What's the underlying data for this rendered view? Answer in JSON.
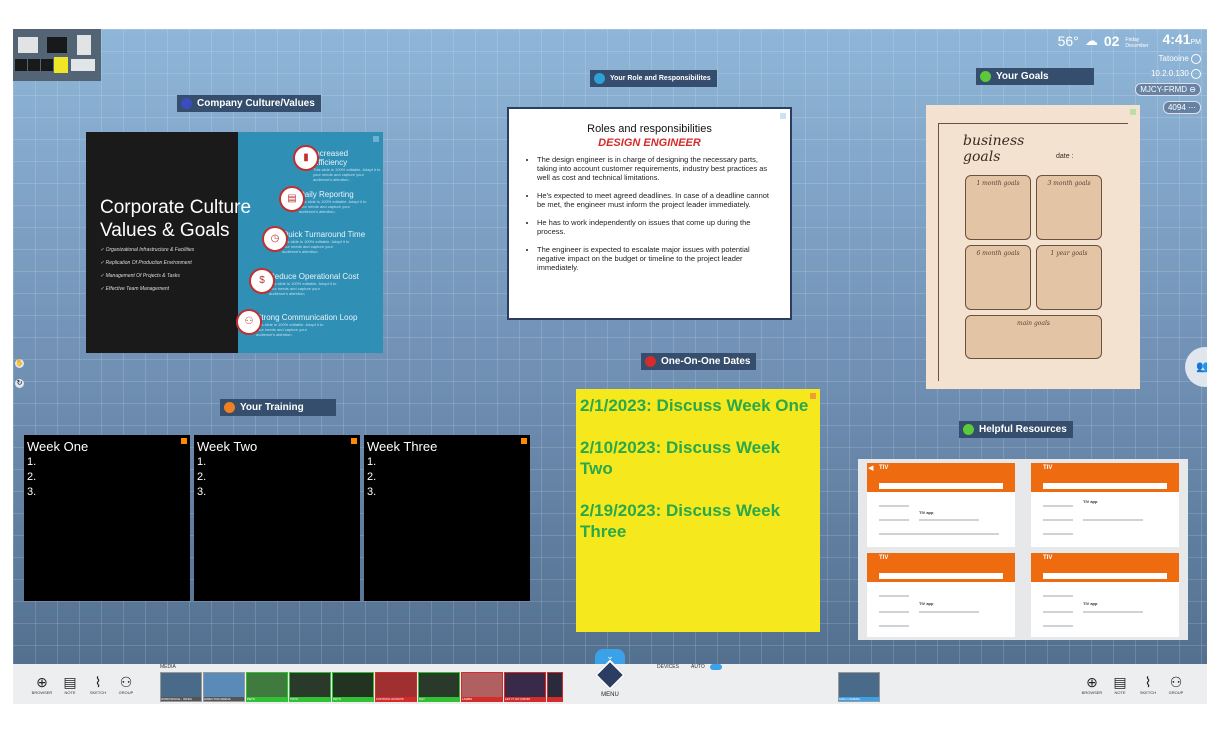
{
  "status": {
    "temperature": "56°",
    "day": "02",
    "day_label_top": "Friday",
    "day_label_bottom": "December",
    "time": "4:41",
    "ampm": "PM",
    "location": "Tatooine",
    "ip": "10.2.0.130",
    "device_code": "MJCY-FRMD",
    "users": "4094"
  },
  "labels": {
    "culture": "Company Culture/Values",
    "role": "Your Role and Responsibilites",
    "goals": "Your Goals",
    "one_on_one": "One-On-One Dates",
    "training": "Your Training",
    "resources": "Helpful Resources"
  },
  "colors": {
    "culture_dot": "#3b4cc0",
    "role_dot": "#2ea0d8",
    "goals_dot": "#5cc93a",
    "one_on_one_dot": "#d42b2b",
    "training_dot": "#f08020",
    "resources_dot": "#5cc93a"
  },
  "culture_slide": {
    "title_line1": "Corporate Culture",
    "title_line2": "Values & Goals",
    "bullets": [
      "Organizational Infrastructure & Facilities",
      "Replication Of Production Environment",
      "Management Of Projects & Tasks",
      "Effective Team Management"
    ],
    "items": [
      {
        "title": "Increased Efficiency",
        "text": "This slide is 100% editable. Adapt it to your needs and capture your audience's attention."
      },
      {
        "title": "Daily Reporting",
        "text": "This slide is 100% editable. Adapt it to your needs and capture your audience's attention."
      },
      {
        "title": "Quick Turnaround Time",
        "text": "This slide is 100% editable. Adapt it to your needs and capture your audience's attention."
      },
      {
        "title": "Reduce Operational Cost",
        "text": "This slide is 100% editable. Adapt it to your needs and capture your audience's attention."
      },
      {
        "title": "Strong Communication Loop",
        "text": "This slide is 100% editable. Adapt it to your needs and capture your audience's attention."
      }
    ]
  },
  "roles": {
    "title": "Roles and responsibilities",
    "subtitle": "DESIGN ENGINEER",
    "items": [
      "The design engineer is in charge of designing the necessary parts, taking into account customer requirements, industry best practices as well as cost and technical limitations.",
      "He's expected to meet agreed deadlines. In case of a deadline cannot be met, the engineer must inform the project leader immediately.",
      "He has to work independently on issues that come up during the process.",
      "The engineer is expected to escalate major issues with potential negative impact on the budget or timeline to the project leader immediately."
    ]
  },
  "goals_card": {
    "title_line1": "business",
    "title_line2": "goals",
    "date_label": "date :",
    "boxes": [
      "1 month goals",
      "3 month goals",
      "6 month goals",
      "1 year goals",
      "main goals"
    ]
  },
  "training": [
    {
      "title": "Week One",
      "lines": "1.\n2.\n3."
    },
    {
      "title": "Week Two",
      "lines": "1.\n2.\n3."
    },
    {
      "title": "Week Three",
      "lines": "1.\n2.\n3."
    }
  ],
  "one_on_one_dates": [
    "2/1/2023: Discuss Week One",
    "2/10/2023: Discuss Week Two",
    "2/19/2023: Discuss Week Three"
  ],
  "resources": {
    "card_brand": "TIV",
    "card_heading": "TIV app"
  },
  "toolbar": {
    "browser": "BROWSER",
    "note": "NOTE",
    "sketch": "SKETCH",
    "group": "GROUP",
    "media_label": "MEDIA",
    "devices_label": "DEVICES",
    "auto_label": "AUTO",
    "menu_label": "MENU",
    "thumbs": [
      "WORKSPACE - INFRA",
      "DIRECTOR ARENA",
      "PETS",
      "TOTS",
      "PETS",
      "CONTROL ROOM B",
      "DAY",
      "LAMBS",
      "LET IT GO (FROM",
      ""
    ],
    "device_thumb": "MAIN CAMERA"
  }
}
